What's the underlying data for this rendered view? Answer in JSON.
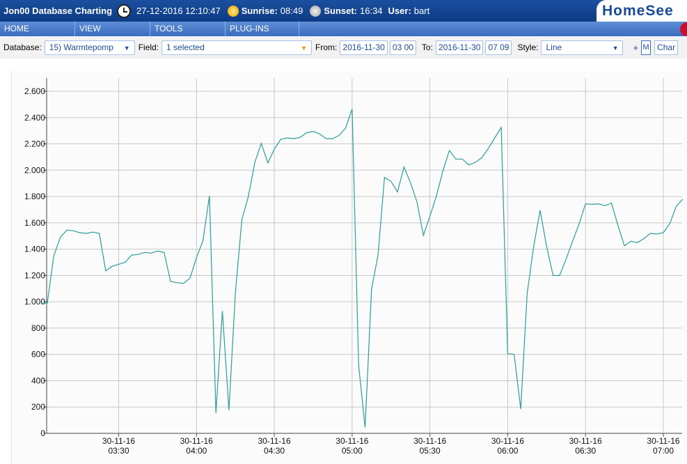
{
  "titlebar": {
    "app_title": "Jon00 Database Charting",
    "datetime": "27-12-2016 12:10:47",
    "sunrise_label": "Sunrise:",
    "sunrise": "08:49",
    "sunset_label": "Sunset:",
    "sunset": "16:34",
    "user_label": "User:",
    "user": "bart",
    "logo_text": "HomeSee"
  },
  "menu": {
    "items": [
      "HOME",
      "VIEW",
      "TOOLS",
      "PLUG-INS"
    ]
  },
  "toolbar": {
    "database_label": "Database:",
    "database_value": "15) Warmtepomp",
    "field_label": "Field:",
    "field_value": "1 selected",
    "from_label": "From:",
    "from_date": "2016-11-30",
    "from_time": "03 00",
    "to_label": "To:",
    "to_date": "2016-11-30",
    "to_time": "07 09",
    "style_label": "Style:",
    "style_value": "Line",
    "plus": "+",
    "mini_value": "M",
    "chart_button": "Char"
  },
  "colors": {
    "line": "#2a9d9b",
    "grid": "#c8c8c8",
    "title_bar": "#0d3b85",
    "menu_bar": "#3a6cc0",
    "accent_text": "#1d4d9e"
  },
  "chart_data": {
    "type": "line",
    "title": "",
    "xlabel": "",
    "ylabel": "",
    "xlim_minutes": [
      0,
      309
    ],
    "ylim": [
      0,
      2600
    ],
    "yticks": [
      0,
      200,
      400,
      600,
      800,
      1000,
      1200,
      1400,
      1600,
      1800,
      2000,
      2200,
      2400,
      2600
    ],
    "ytick_labels": [
      "0",
      "200",
      "400",
      "600",
      "800",
      "1.000",
      "1.200",
      "1.400",
      "1.600",
      "1.800",
      "2.000",
      "2.200",
      "2.400",
      "2.600"
    ],
    "xticks": [
      {
        "minute": 30,
        "date": "30-11-16",
        "time": "03:30"
      },
      {
        "minute": 60,
        "date": "30-11-16",
        "time": "04:00"
      },
      {
        "minute": 90,
        "date": "30-11-16",
        "time": "04:30"
      },
      {
        "minute": 120,
        "date": "30-11-16",
        "time": "05:00"
      },
      {
        "minute": 150,
        "date": "30-11-16",
        "time": "05:30"
      },
      {
        "minute": 180,
        "date": "30-11-16",
        "time": "06:00"
      },
      {
        "minute": 210,
        "date": "30-11-16",
        "time": "06:30"
      },
      {
        "minute": 240,
        "date": "30-11-16",
        "time": "07:00"
      }
    ],
    "grid": true,
    "series": [
      {
        "values": [
          [
            0.0,
            985
          ],
          [
            2.5,
            990
          ],
          [
            5.0,
            1350
          ],
          [
            7.5,
            1490
          ],
          [
            10.0,
            1545
          ],
          [
            12.5,
            1540
          ],
          [
            15.0,
            1525
          ],
          [
            17.5,
            1520
          ],
          [
            20.0,
            1530
          ],
          [
            22.5,
            1520
          ],
          [
            25.0,
            1235
          ],
          [
            27.5,
            1270
          ],
          [
            30.0,
            1285
          ],
          [
            32.5,
            1300
          ],
          [
            35.0,
            1355
          ],
          [
            37.5,
            1360
          ],
          [
            40.0,
            1375
          ],
          [
            42.5,
            1370
          ],
          [
            45.0,
            1385
          ],
          [
            47.5,
            1375
          ],
          [
            50.0,
            1155
          ],
          [
            52.5,
            1145
          ],
          [
            55.0,
            1140
          ],
          [
            57.5,
            1180
          ],
          [
            60.0,
            1335
          ],
          [
            62.5,
            1465
          ],
          [
            65.0,
            1805
          ],
          [
            67.5,
            155
          ],
          [
            70.0,
            930
          ],
          [
            72.5,
            175
          ],
          [
            75.0,
            1070
          ],
          [
            77.5,
            1625
          ],
          [
            80.0,
            1800
          ],
          [
            82.5,
            2060
          ],
          [
            85.0,
            2205
          ],
          [
            87.5,
            2055
          ],
          [
            90.0,
            2160
          ],
          [
            92.5,
            2235
          ],
          [
            95.0,
            2245
          ],
          [
            97.5,
            2240
          ],
          [
            100.0,
            2250
          ],
          [
            102.5,
            2285
          ],
          [
            105.0,
            2295
          ],
          [
            107.5,
            2275
          ],
          [
            110.0,
            2240
          ],
          [
            112.5,
            2240
          ],
          [
            115.0,
            2265
          ],
          [
            117.5,
            2320
          ],
          [
            120.0,
            2465
          ],
          [
            122.5,
            520
          ],
          [
            125.0,
            45
          ],
          [
            127.5,
            1095
          ],
          [
            130.0,
            1355
          ],
          [
            132.5,
            1945
          ],
          [
            135.0,
            1915
          ],
          [
            137.5,
            1835
          ],
          [
            140.0,
            2025
          ],
          [
            142.5,
            1905
          ],
          [
            145.0,
            1760
          ],
          [
            147.5,
            1505
          ],
          [
            150.0,
            1650
          ],
          [
            152.5,
            1805
          ],
          [
            155.0,
            1995
          ],
          [
            157.5,
            2150
          ],
          [
            160.0,
            2085
          ],
          [
            162.5,
            2085
          ],
          [
            165.0,
            2040
          ],
          [
            167.5,
            2060
          ],
          [
            170.0,
            2095
          ],
          [
            172.5,
            2165
          ],
          [
            175.0,
            2245
          ],
          [
            177.5,
            2325
          ],
          [
            180.0,
            605
          ],
          [
            182.5,
            600
          ],
          [
            185.0,
            185
          ],
          [
            187.5,
            1065
          ],
          [
            190.0,
            1420
          ],
          [
            192.5,
            1695
          ],
          [
            195.0,
            1420
          ],
          [
            197.5,
            1200
          ],
          [
            200.0,
            1200
          ],
          [
            202.5,
            1325
          ],
          [
            205.0,
            1460
          ],
          [
            207.5,
            1590
          ],
          [
            210.0,
            1745
          ],
          [
            212.5,
            1740
          ],
          [
            215.0,
            1745
          ],
          [
            217.5,
            1730
          ],
          [
            220.0,
            1750
          ],
          [
            222.5,
            1580
          ],
          [
            225.0,
            1425
          ],
          [
            227.5,
            1460
          ],
          [
            230.0,
            1450
          ],
          [
            232.5,
            1480
          ],
          [
            235.0,
            1520
          ],
          [
            237.5,
            1515
          ],
          [
            240.0,
            1525
          ],
          [
            242.5,
            1595
          ],
          [
            245.0,
            1725
          ],
          [
            247.5,
            1780
          ]
        ]
      }
    ]
  }
}
